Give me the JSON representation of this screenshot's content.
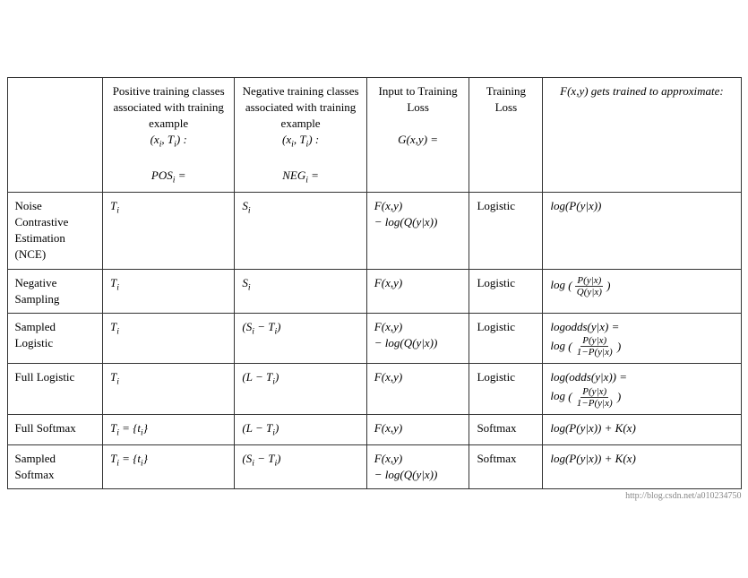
{
  "table": {
    "header": {
      "col1": "",
      "col2_line1": "Positive training",
      "col2_line2": "classes",
      "col2_line3": "associated with",
      "col2_line4": "training example",
      "col2_line5": "(xᵢ, Tᵢ) :",
      "col2_line6": "POSᵢ =",
      "col3_line1": "Negative training",
      "col3_line2": "classes",
      "col3_line3": "associated with",
      "col3_line4": "training example",
      "col3_line5": "(xᵢ, Tᵢ) :",
      "col3_line6": "NEGᵢ =",
      "col4_line1": "Input to",
      "col4_line2": "Training",
      "col4_line3": "Loss",
      "col4_line4": "G(x,y) =",
      "col5": "Training Loss",
      "col6_line1": "F(x,y) gets",
      "col6_line2": "trained to",
      "col6_line3": "approximate:"
    },
    "rows": [
      {
        "method": "Noise Contrastive Estimation (NCE)",
        "pos": "Tᵢ",
        "neg": "Sᵢ",
        "input": "F(x,y) − log(Q(y|x))",
        "loss": "Logistic",
        "approx": "log(P(y|x))"
      },
      {
        "method": "Negative Sampling",
        "pos": "Tᵢ",
        "neg": "Sᵢ",
        "input": "F(x,y)",
        "loss": "Logistic",
        "approx": "log(P(y|x)/Q(y|x))"
      },
      {
        "method": "Sampled Logistic",
        "pos": "Tᵢ",
        "neg": "(Sᵢ − Tᵢ)",
        "input": "F(x,y) − log(Q(y|x))",
        "loss": "Logistic",
        "approx": "logodds(y|x) = log(P(y|x)/1−P(y|x))"
      },
      {
        "method": "Full Logistic",
        "pos": "Tᵢ",
        "neg": "(L − Tᵢ)",
        "input": "F(x,y)",
        "loss": "Logistic",
        "approx": "log(odds(y|x)) = log(P(y|x)/1−P(y|x))"
      },
      {
        "method": "Full Softmax",
        "pos": "Tᵢ = {tᵢ}",
        "neg": "(L − Tᵢ)",
        "input": "F(x,y)",
        "loss": "Softmax",
        "approx": "log(P(y|x)) + K(x)"
      },
      {
        "method": "Sampled Softmax",
        "pos": "Tᵢ = {tᵢ}",
        "neg": "(Sᵢ − Tᵢ)",
        "input": "F(x,y) − log(Q(y|x))",
        "loss": "Softmax",
        "approx": "log(P(y|x)) + K(x)"
      }
    ]
  },
  "watermark": "http://blog.csdn.net/a010234750"
}
